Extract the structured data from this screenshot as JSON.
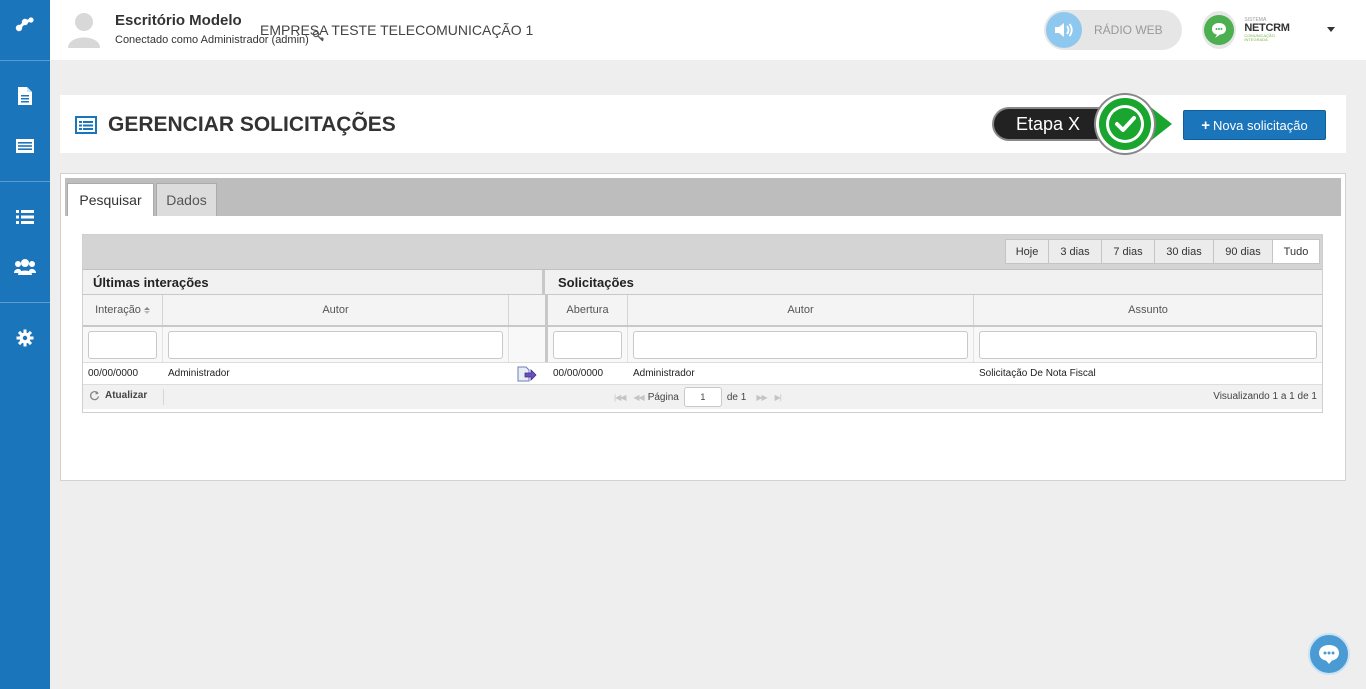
{
  "header": {
    "company_name": "Escritório Modelo",
    "connected_as": "Conectado como Administrador (admin)",
    "enterprise": "EMPRESA TESTE TELECOMUNICAÇÃO 1",
    "radio_label": "RÁDIO WEB",
    "netcrm_small": "SISTEMA",
    "netcrm_brand": "NETCRM",
    "netcrm_tag": "COMUNICAÇÃO INTEGRADA"
  },
  "sidebar": {
    "items": [
      {
        "icon": "document-icon"
      },
      {
        "icon": "form-icon"
      },
      {
        "icon": "list-icon"
      },
      {
        "icon": "users-icon"
      },
      {
        "icon": "gear-icon"
      }
    ]
  },
  "title_panel": {
    "title": "GERENCIAR SOLICITAÇÕES",
    "step_label": "Etapa X",
    "new_button": "Nova solicitação",
    "new_button_plus": "+"
  },
  "tabs": [
    {
      "label": "Pesquisar",
      "active": true
    },
    {
      "label": "Dados",
      "active": false
    }
  ],
  "filters": [
    "Hoje",
    "3 dias",
    "7 dias",
    "30 dias",
    "90 dias",
    "Tudo"
  ],
  "grid": {
    "group_left": "Últimas interações",
    "group_right": "Solicitações",
    "columns": [
      "Interação",
      "Autor",
      "",
      "Abertura",
      "Autor",
      "Assunto"
    ],
    "row": {
      "interacao": "00/00/0000",
      "autor_int": "Administrador",
      "abertura": "00/00/0000",
      "autor_sol": "Administrador",
      "assunto": "Solicitação De Nota Fiscal"
    }
  },
  "pager": {
    "refresh": "Atualizar",
    "page_label": "Página",
    "page_value": "1",
    "of_label": "de 1",
    "view_info": "Visualizando 1 a 1 de 1"
  },
  "colors": {
    "sidebar": "#1b75bb",
    "accent_green": "#1aa52f",
    "primary_button": "#1b75bb"
  }
}
